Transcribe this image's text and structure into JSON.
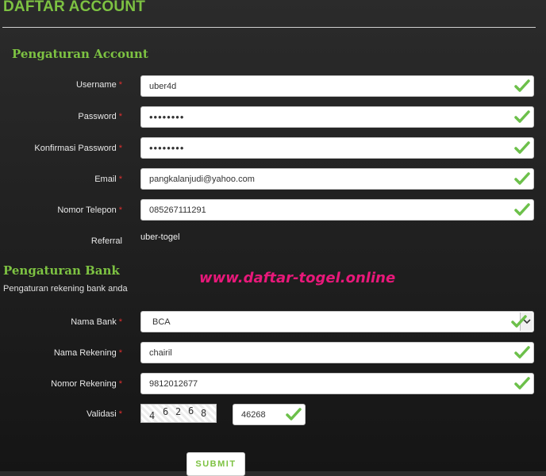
{
  "page": {
    "title": "DAFTAR ACCOUNT"
  },
  "account": {
    "heading": "Pengaturan Account",
    "username": {
      "label": "Username",
      "value": "uber4d"
    },
    "password": {
      "label": "Password",
      "value": "••••••••"
    },
    "confirm_password": {
      "label": "Konfirmasi Password",
      "value": "••••••••"
    },
    "email": {
      "label": "Email",
      "value": "pangkalanjudi@yahoo.com"
    },
    "phone": {
      "label": "Nomor Telepon",
      "value": "085267111291"
    },
    "referral": {
      "label": "Referral",
      "value": "uber-togel"
    }
  },
  "watermark": "www.daftar-togel.online",
  "bank": {
    "heading": "Pengaturan Bank",
    "subtitle": "Pengaturan rekening bank anda",
    "bank_name": {
      "label": "Nama Bank",
      "value": "BCA"
    },
    "account_name": {
      "label": "Nama Rekening",
      "value": "chairil"
    },
    "account_number": {
      "label": "Nomor Rekening",
      "value": "9812012677"
    },
    "validation": {
      "label": "Validasi",
      "captcha": [
        "4",
        "6",
        "2",
        "6",
        "8"
      ],
      "value": "46268"
    }
  },
  "required_mark": "*",
  "submit_label": "SUBMIT",
  "colors": {
    "accent": "#7dc242",
    "required": "#e03030",
    "watermark": "#e8187a",
    "check": "#6cc04a"
  }
}
